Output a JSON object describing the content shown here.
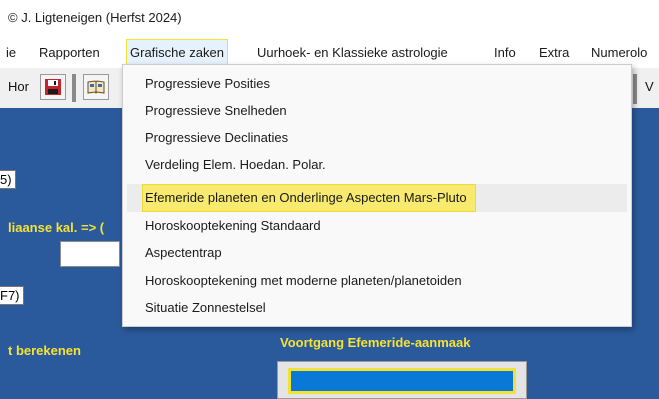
{
  "window": {
    "title": "© J. Ligteneigen (Herfst 2024)"
  },
  "menubar": {
    "items": [
      {
        "label": "ie",
        "active": false
      },
      {
        "label": "Rapporten",
        "active": false
      },
      {
        "label": "Grafische zaken",
        "active": true
      },
      {
        "label": "Uurhoek- en Klassieke astrologie",
        "active": false
      },
      {
        "label": "Info",
        "active": false
      },
      {
        "label": "Extra",
        "active": false
      },
      {
        "label": "Numerolo",
        "active": false
      }
    ]
  },
  "toolbar": {
    "label": "Hor",
    "save_icon": "floppy-disk-icon",
    "book_icon": "book-icon",
    "right_letter": "V"
  },
  "workspace": {
    "side_texts": [
      "5)",
      "F7)"
    ],
    "julian_label": "liaanse kal. => (",
    "calc_label": "t berekenen",
    "progress_title": "Voortgang Efemeride-aanmaak",
    "progress": 1.0,
    "colors": {
      "background": "#2b5a9c",
      "label": "#f5e234",
      "progress": "#0a78d7"
    }
  },
  "dropdown": {
    "items": [
      {
        "label": "Progressieve Posities"
      },
      {
        "label": "Progressieve Snelheden"
      },
      {
        "label": "Progressieve Declinaties"
      },
      {
        "label": "Verdeling Elem. Hoedan. Polar."
      },
      {
        "label": "Efemeride planeten en Onderlinge Aspecten Mars-Pluto",
        "selected": true
      },
      {
        "label": "Horoskooptekening Standaard"
      },
      {
        "label": "Aspectentrap"
      },
      {
        "label": "Horoskooptekening met moderne planeten/planetoiden"
      },
      {
        "label": "Situatie Zonnestelsel"
      }
    ]
  }
}
